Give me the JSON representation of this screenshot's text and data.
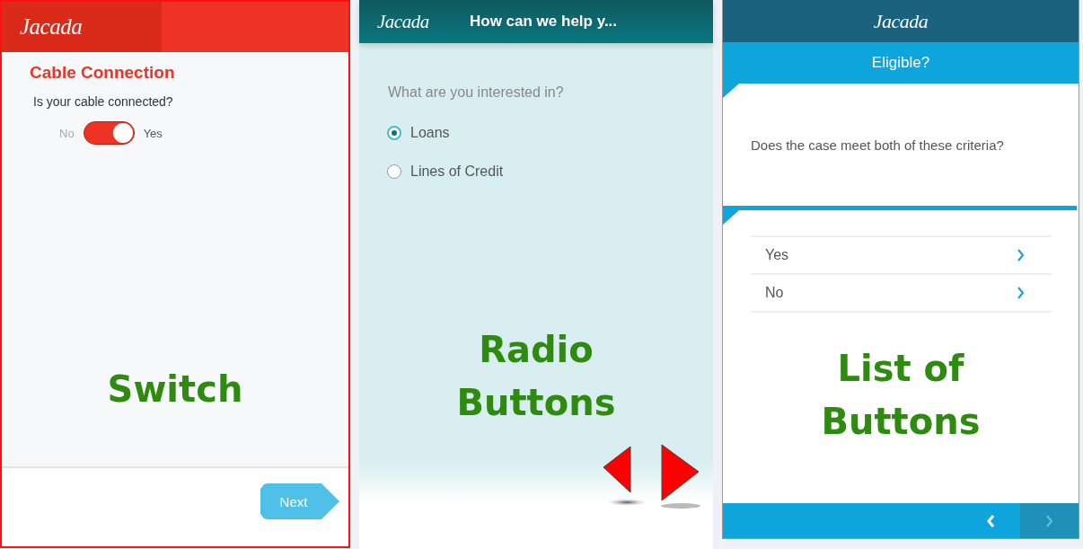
{
  "switch_screen": {
    "logo": "Jacada",
    "title": "Cable Connection",
    "question": "Is your cable connected?",
    "switch": {
      "off_label": "No",
      "on_label": "Yes",
      "on": true
    },
    "next_button": "Next",
    "caption": "Switch"
  },
  "radio_screen": {
    "logo": "Jacada",
    "header_title": "How can we help y...",
    "question": "What are you interested in?",
    "options": [
      {
        "label": "Loans",
        "selected": true
      },
      {
        "label": "Lines of Credit",
        "selected": false
      }
    ],
    "caption": "Radio Buttons",
    "arrows": [
      {
        "kind": "back"
      },
      {
        "kind": "next"
      }
    ]
  },
  "list_screen": {
    "logo": "Jacada",
    "subtitle": "Eligible?",
    "question": "Does the case meet both of these criteria?",
    "options": [
      {
        "label": "Yes"
      },
      {
        "label": "No"
      }
    ],
    "caption": "List of Buttons",
    "nav": [
      {
        "kind": "back",
        "disabled": false
      },
      {
        "kind": "next",
        "disabled": true
      }
    ]
  }
}
